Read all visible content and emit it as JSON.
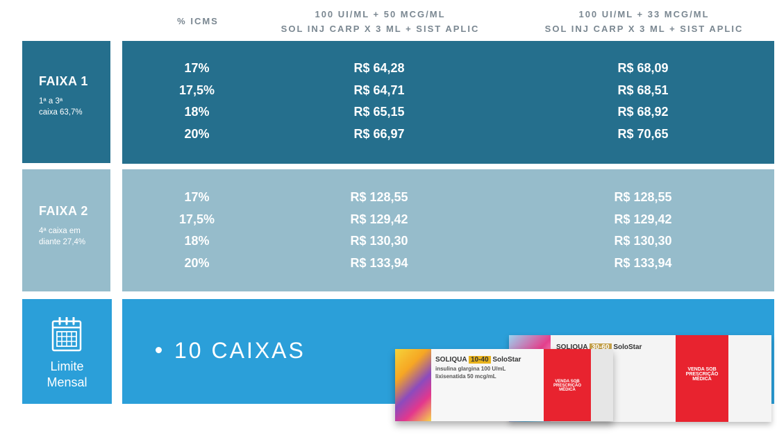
{
  "header": {
    "col1": "% ICMS",
    "col2_line1": "100 UI/ML + 50 MCG/ML",
    "col2_line2": "SOL INJ CARP X 3 ML + SIST APLIC",
    "col3_line1": "100 UI/ML + 33 MCG/ML",
    "col3_line2": "SOL INJ CARP X 3 ML + SIST APLIC"
  },
  "faixa1": {
    "title": "FAIXA 1",
    "sub_line1": "1ª a 3ª",
    "sub_line2": "caixa 63,7%",
    "icms": [
      "17%",
      "17,5%",
      "18%",
      "20%"
    ],
    "price_a": [
      "R$ 64,28",
      "R$ 64,71",
      "R$ 65,15",
      "R$ 66,97"
    ],
    "price_b": [
      "R$ 68,09",
      "R$ 68,51",
      "R$ 68,92",
      "R$ 70,65"
    ]
  },
  "faixa2": {
    "title": "FAIXA 2",
    "sub_line1": "4ª caixa em",
    "sub_line2": "diante 27,4%",
    "icms": [
      "17%",
      "17,5%",
      "18%",
      "20%"
    ],
    "price_a": [
      "R$ 128,55",
      "R$ 129,42",
      "R$ 130,30",
      "R$ 133,94"
    ],
    "price_b": [
      "R$ 128,55",
      "R$ 129,42",
      "R$ 130,30",
      "R$ 133,94"
    ]
  },
  "limite": {
    "label_line1": "Limite",
    "label_line2": "Mensal",
    "bullet": "10 CAIXAS",
    "icon": "calendar-icon"
  },
  "product_boxes": {
    "front_brand": "SOLIQUA",
    "front_dose": "10-40",
    "front_pen": "SoloStar",
    "front_line1": "insulina glargina 100 U/mL",
    "front_line2": "lixisenatida 50 mcg/mL",
    "back_brand": "SOLIQUA",
    "back_dose": "30-60",
    "back_pen": "SoloStar",
    "rx_label": "VENDA SOB PRESCRIÇÃO MÉDICA"
  },
  "colors": {
    "faixa1": "#256f8d",
    "faixa2": "#96bccb",
    "limite": "#2b9fd9",
    "header_text": "#7a8791",
    "box_red": "#e8232f"
  }
}
